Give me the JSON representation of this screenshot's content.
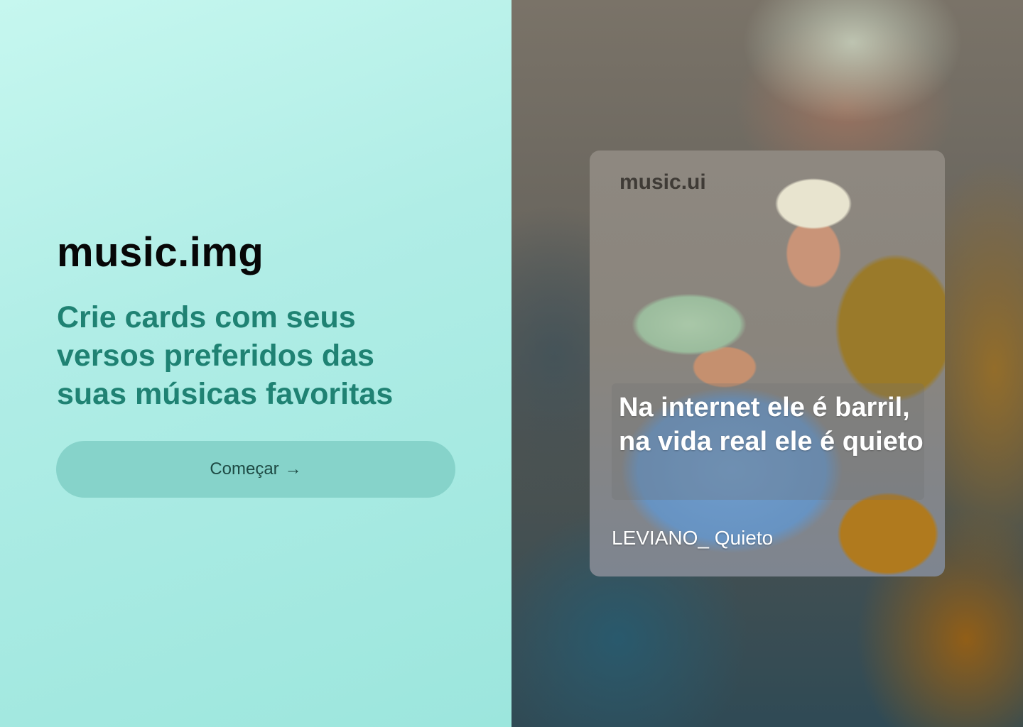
{
  "left": {
    "brand": "music.img",
    "tagline": "Crie cards com seus versos preferidos das suas músicas favoritas",
    "cta_label": "Começar",
    "cta_icon": "arrow-right-icon",
    "colors": {
      "background": "#b0ede6",
      "tagline": "#1f8273",
      "button": "#86d3ca"
    }
  },
  "card": {
    "logo": "music.ui",
    "lyric": "Na internet ele é barril, na vida real ele é quieto",
    "song": "LEVIANO_ Quieto"
  }
}
